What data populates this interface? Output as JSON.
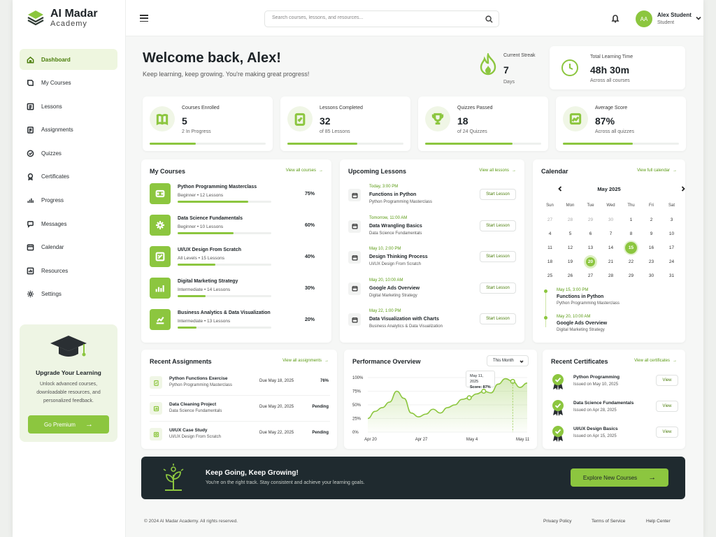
{
  "brand": {
    "name": "AI Madar",
    "sub": "Academy"
  },
  "colors": {
    "accent": "#8cc63f",
    "accent_dark": "#4a7d0a",
    "banner_bg": "#1f2a2f"
  },
  "sidebar": {
    "items": [
      {
        "label": "Dashboard",
        "icon": "home-icon",
        "active": true
      },
      {
        "label": "My Courses",
        "icon": "book-icon"
      },
      {
        "label": "Lessons",
        "icon": "lessons-icon"
      },
      {
        "label": "Assignments",
        "icon": "clipboard-icon"
      },
      {
        "label": "Quizzes",
        "icon": "quiz-icon"
      },
      {
        "label": "Certificates",
        "icon": "certificate-icon"
      },
      {
        "label": "Progress",
        "icon": "bar-chart-icon"
      },
      {
        "label": "Messages",
        "icon": "message-icon"
      },
      {
        "label": "Calendar",
        "icon": "calendar-icon"
      },
      {
        "label": "Resources",
        "icon": "resources-icon"
      },
      {
        "label": "Settings",
        "icon": "gear-icon"
      }
    ],
    "upgrade": {
      "title": "Upgrade Your Learning",
      "text": "Unlock advanced courses, downloadable resources, and personalized feedback.",
      "button": "Go Premium"
    }
  },
  "topbar": {
    "search_placeholder": "Search courses, lessons, and resources...",
    "user": {
      "initials": "AA",
      "name": "Alex Student",
      "role": "Student"
    }
  },
  "welcome": {
    "title": "Welcome back, Alex!",
    "subtitle": "Keep learning, keep growing. You're making great progress!"
  },
  "streak": {
    "label": "Current Streak",
    "value": "7",
    "unit": "Days"
  },
  "total_time": {
    "label": "Total Learning Time",
    "value": "48h 30m",
    "sub": "Across all courses"
  },
  "stats": [
    {
      "label": "Courses Enrolled",
      "value": "5",
      "sub": "2 In Progress",
      "progress": 0.4
    },
    {
      "label": "Lessons Completed",
      "value": "32",
      "sub": "of 85 Lessons",
      "progress": 0.6
    },
    {
      "label": "Quizzes Passed",
      "value": "18",
      "sub": "of 24 Quizzes",
      "progress": 0.75
    },
    {
      "label": "Average Score",
      "value": "87%",
      "sub": "Across all quizzes",
      "progress": 0.6
    }
  ],
  "my_courses": {
    "title": "My Courses",
    "link": "View all courses",
    "items": [
      {
        "name": "Python Programming Masterclass",
        "level": "Beginner",
        "lessons": "12 Lessons",
        "percent": "75%",
        "progress": 0.75
      },
      {
        "name": "Data Science Fundamentals",
        "level": "Beginner",
        "lessons": "10 Lessons",
        "percent": "60%",
        "progress": 0.6
      },
      {
        "name": "UI/UX Design From Scratch",
        "level": "All Levels",
        "lessons": "15 Lessons",
        "percent": "40%",
        "progress": 0.4
      },
      {
        "name": "Digital Marketing Strategy",
        "level": "Intermediate",
        "lessons": "14 Lessons",
        "percent": "30%",
        "progress": 0.3
      },
      {
        "name": "Business Analytics & Data Visualization",
        "level": "Intermediate",
        "lessons": "13 Lessons",
        "percent": "20%",
        "progress": 0.2
      }
    ]
  },
  "upcoming": {
    "title": "Upcoming Lessons",
    "link": "View all lessons",
    "button": "Start Lesson",
    "items": [
      {
        "time": "Today, 3:00 PM",
        "name": "Functions in Python",
        "course": "Python Programming Masterclass"
      },
      {
        "time": "Tomorrow, 11:00 AM",
        "name": "Data Wrangling Basics",
        "course": "Data Science Fundamentals"
      },
      {
        "time": "May 10, 2:00 PM",
        "name": "Design Thinking Process",
        "course": "UI/UX Design From Scratch"
      },
      {
        "time": "May 20, 10:00 AM",
        "name": "Google Ads Overview",
        "course": "Digital Marketing Strategy"
      },
      {
        "time": "May 22, 1:00 PM",
        "name": "Data Visualization with Charts",
        "course": "Business Analytics & Data Visualization"
      }
    ]
  },
  "calendar": {
    "title": "Calendar",
    "link": "View full calendar",
    "month": "May 2025",
    "dows": [
      "Sun",
      "Mon",
      "Tue",
      "Wed",
      "Thu",
      "Fri",
      "Sat"
    ],
    "days": [
      {
        "d": "27",
        "m": true
      },
      {
        "d": "28",
        "m": true
      },
      {
        "d": "29",
        "m": true
      },
      {
        "d": "30",
        "m": true
      },
      {
        "d": "1"
      },
      {
        "d": "2"
      },
      {
        "d": "3"
      },
      {
        "d": "4"
      },
      {
        "d": "5"
      },
      {
        "d": "6"
      },
      {
        "d": "7"
      },
      {
        "d": "8"
      },
      {
        "d": "9"
      },
      {
        "d": "10"
      },
      {
        "d": "11"
      },
      {
        "d": "12"
      },
      {
        "d": "13"
      },
      {
        "d": "14"
      },
      {
        "d": "15",
        "sel": true
      },
      {
        "d": "16"
      },
      {
        "d": "17"
      },
      {
        "d": "18"
      },
      {
        "d": "19"
      },
      {
        "d": "20",
        "today": true
      },
      {
        "d": "21"
      },
      {
        "d": "22"
      },
      {
        "d": "23"
      },
      {
        "d": "24"
      },
      {
        "d": "25"
      },
      {
        "d": "26"
      },
      {
        "d": "27"
      },
      {
        "d": "28"
      },
      {
        "d": "29"
      },
      {
        "d": "30"
      },
      {
        "d": "31"
      }
    ],
    "events": [
      {
        "time": "May 15, 3:00 PM",
        "name": "Functions in Python",
        "course": "Python Programming Masterclass"
      },
      {
        "time": "May 20, 10:00 AM",
        "name": "Google Ads Overview",
        "course": "Digital Marketing Strategy"
      }
    ]
  },
  "assignments": {
    "title": "Recent Assignments",
    "link": "View all assignments",
    "items": [
      {
        "name": "Python Functions Exercise",
        "course": "Python Programming Masterclass",
        "due": "Due May 18, 2025",
        "status": "76%"
      },
      {
        "name": "Data Cleaning Project",
        "course": "Data Science Fundamentals",
        "due": "Due May 20, 2025",
        "status": "Pending"
      },
      {
        "name": "UI/UX Case Study",
        "course": "UI/UX Design From Scratch",
        "due": "Due May 22, 2025",
        "status": "Pending"
      }
    ]
  },
  "performance": {
    "title": "Performance Overview",
    "period": "This Month",
    "tooltip_date": "May 11, 2025",
    "tooltip_score": "Score: 87%"
  },
  "chart_data": {
    "type": "area",
    "title": "Performance Overview",
    "y_ticks": [
      "100%",
      "75%",
      "50%",
      "25%",
      "0%"
    ],
    "x_ticks": [
      "Apr 20",
      "Apr 27",
      "May 4",
      "May 11"
    ],
    "ylim": [
      0,
      100
    ],
    "xlim": [
      0,
      22
    ],
    "x": [
      0,
      1,
      2,
      3,
      4,
      5,
      6,
      7,
      8,
      9,
      10,
      11,
      12,
      13,
      14,
      15,
      16,
      17,
      18,
      19,
      20,
      21,
      22
    ],
    "values": [
      25,
      38,
      45,
      55,
      75,
      62,
      35,
      28,
      33,
      42,
      35,
      45,
      50,
      60,
      63,
      70,
      75,
      72,
      88,
      98,
      93,
      82,
      90
    ],
    "highlight_points": [
      14,
      16,
      20
    ],
    "grid": true
  },
  "certificates": {
    "title": "Recent Certificates",
    "link": "View all certificates",
    "button": "View",
    "items": [
      {
        "name": "Python Programming",
        "date": "Issued on May 10, 2025"
      },
      {
        "name": "Data Science Fundamentals",
        "date": "Issued on Apr 28, 2025"
      },
      {
        "name": "UI/UX Design Basics",
        "date": "Issued on Apr 15, 2025"
      }
    ]
  },
  "banner": {
    "title": "Keep Going, Keep Growing!",
    "text": "You're on the right track. Stay consistent and achieve your learning goals.",
    "button": "Explore New Courses"
  },
  "footer": {
    "copyright": "© 2024 AI Madar Academy. All rights reserved.",
    "links": [
      "Privacy Policy",
      "Terms of Service",
      "Help Center"
    ]
  }
}
